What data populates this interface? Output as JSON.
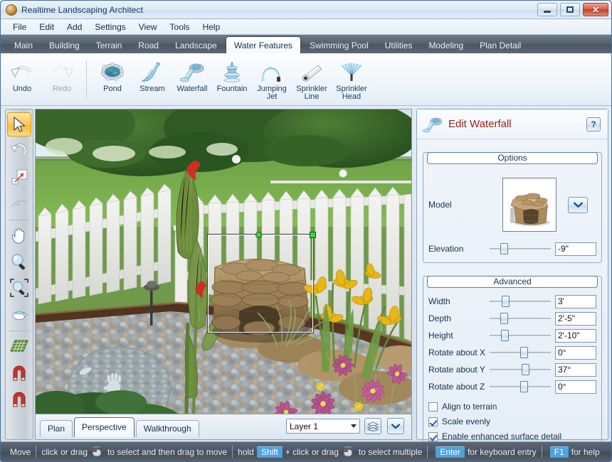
{
  "window": {
    "title": "Realtime Landscaping Architect",
    "app_icon": "app-logo-icon",
    "minimize_label": "Minimize",
    "maximize_label": "Maximize",
    "close_label": "Close",
    "close_glyph": "✕"
  },
  "menubar": {
    "items": [
      "File",
      "Edit",
      "Add",
      "Settings",
      "View",
      "Tools",
      "Help"
    ]
  },
  "tabstrip": {
    "tabs": [
      {
        "label": "Main",
        "active": false
      },
      {
        "label": "Building",
        "active": false
      },
      {
        "label": "Terrain",
        "active": false
      },
      {
        "label": "Road",
        "active": false
      },
      {
        "label": "Landscape",
        "active": false
      },
      {
        "label": "Water Features",
        "active": true
      },
      {
        "label": "Swimming Pool",
        "active": false
      },
      {
        "label": "Utilities",
        "active": false
      },
      {
        "label": "Modeling",
        "active": false
      },
      {
        "label": "Plan Detail",
        "active": false
      }
    ]
  },
  "ribbon": {
    "buttons": [
      {
        "label": "Undo",
        "icon": "undo-arrow-icon",
        "disabled": false
      },
      {
        "label": "Redo",
        "icon": "redo-arrow-icon",
        "disabled": true
      },
      {
        "label": "Pond",
        "icon": "pond-icon",
        "disabled": false
      },
      {
        "label": "Stream",
        "icon": "stream-icon",
        "disabled": false
      },
      {
        "label": "Waterfall",
        "icon": "waterfall-icon",
        "disabled": false
      },
      {
        "label": "Fountain",
        "icon": "fountain-icon",
        "disabled": false
      },
      {
        "label": "Jumping Jet",
        "icon": "jumping-jet-icon",
        "disabled": false
      },
      {
        "label": "Sprinkler Line",
        "icon": "sprinkler-line-icon",
        "disabled": false
      },
      {
        "label": "Sprinkler Head",
        "icon": "sprinkler-head-icon",
        "disabled": false
      }
    ]
  },
  "lefttoolbar": {
    "tools": [
      {
        "name": "select-arrow-tool",
        "selected": true,
        "dim": false
      },
      {
        "name": "rotate-tool",
        "selected": false,
        "dim": false
      },
      {
        "name": "resize-tool",
        "selected": false,
        "dim": false
      },
      {
        "name": "curve-edit-tool",
        "selected": false,
        "dim": true
      },
      {
        "name": "pan-hand-tool",
        "selected": false,
        "dim": false
      },
      {
        "name": "zoom-tool",
        "selected": false,
        "dim": false
      },
      {
        "name": "zoom-window-tool",
        "selected": false,
        "dim": false
      },
      {
        "name": "orbit-tool",
        "selected": false,
        "dim": false
      },
      {
        "name": "grid-tool",
        "selected": false,
        "dim": false
      },
      {
        "name": "snap-magnet-tool",
        "selected": false,
        "dim": false
      },
      {
        "name": "magnet-tool-2",
        "selected": false,
        "dim": false
      }
    ]
  },
  "viewport": {
    "scene_description": "3D perspective view of a landscaped garden bed with white picket fence, waterfall rock feature, gravel, canna lilies, yellow iris and pink flowers",
    "selection": {
      "label": "selected-waterfall-bounding-box"
    }
  },
  "viewtabs": {
    "tabs": [
      {
        "label": "Plan",
        "active": false
      },
      {
        "label": "Perspective",
        "active": true
      },
      {
        "label": "Walkthrough",
        "active": false
      }
    ],
    "layer_value": "Layer 1",
    "layers_button": "layers-icon",
    "layers_dropdown": "chevron-down-icon"
  },
  "panel": {
    "icon": "waterfall-icon",
    "title": "Edit Waterfall",
    "help_label": "?",
    "options": {
      "title": "Options",
      "model_label": "Model",
      "model_thumb": "waterfall-rock-model-thumbnail",
      "model_dropdown": "chevron-down-icon",
      "elevation_label": "Elevation",
      "elevation_value": "-9\"",
      "elevation_pct": 18
    },
    "advanced": {
      "title": "Advanced",
      "sliders": [
        {
          "label": "Width",
          "value": "3'",
          "pct": 20
        },
        {
          "label": "Depth",
          "value": "2'-5\"",
          "pct": 18
        },
        {
          "label": "Height",
          "value": "2'-10\"",
          "pct": 19
        },
        {
          "label": "Rotate about X",
          "value": "0°",
          "pct": 50
        },
        {
          "label": "Rotate about Y",
          "value": "37°",
          "pct": 52
        },
        {
          "label": "Rotate about Z",
          "value": "0°",
          "pct": 50
        }
      ],
      "checkboxes": [
        {
          "label": "Align to terrain",
          "checked": false
        },
        {
          "label": "Scale evenly",
          "checked": true
        },
        {
          "label": "Enable enhanced surface detail",
          "checked": true
        }
      ]
    }
  },
  "statusbar": {
    "mode": "Move",
    "seg1_pre": "click or drag",
    "seg1_post": "to select and then drag to move",
    "seg2_pre": "hold",
    "seg2_key": "Shift",
    "seg2_mid": "+ click or drag",
    "seg2_post": "to select multiple",
    "seg3_key": "Enter",
    "seg3_post": "for keyboard entry",
    "seg4_key": "F1",
    "seg4_post": "for help",
    "mouse_icon": "mouse-click-icon"
  },
  "colors": {
    "accent_blue": "#4ca3e0",
    "panel_title_red": "#9c1e1e",
    "ribbon_dark": "#4b5663",
    "selection_green": "#3fd23f"
  }
}
